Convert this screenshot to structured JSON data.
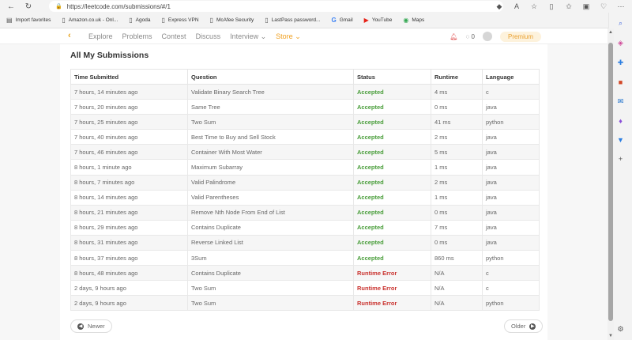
{
  "browser": {
    "url": "https://leetcode.com/submissions/#/1",
    "bookmarks": [
      {
        "label": "Import favorites"
      },
      {
        "label": "Amazon.co.uk - Onl..."
      },
      {
        "label": "Agoda"
      },
      {
        "label": "Express VPN"
      },
      {
        "label": "McAfee Security"
      },
      {
        "label": "LastPass password..."
      },
      {
        "label": "Gmail"
      },
      {
        "label": "YouTube"
      },
      {
        "label": "Maps"
      }
    ]
  },
  "header": {
    "nav": [
      "Explore",
      "Problems",
      "Contest",
      "Discuss",
      "Interview",
      "Store"
    ],
    "coins": "0",
    "premium": "Premium"
  },
  "page": {
    "title": "All My Submissions",
    "columns": [
      "Time Submitted",
      "Question",
      "Status",
      "Runtime",
      "Language"
    ],
    "rows": [
      {
        "time": "7 hours, 14 minutes ago",
        "question": "Validate Binary Search Tree",
        "status": "Accepted",
        "runtime": "4 ms",
        "lang": "c"
      },
      {
        "time": "7 hours, 20 minutes ago",
        "question": "Same Tree",
        "status": "Accepted",
        "runtime": "0 ms",
        "lang": "java"
      },
      {
        "time": "7 hours, 25 minutes ago",
        "question": "Two Sum",
        "status": "Accepted",
        "runtime": "41 ms",
        "lang": "python"
      },
      {
        "time": "7 hours, 40 minutes ago",
        "question": "Best Time to Buy and Sell Stock",
        "status": "Accepted",
        "runtime": "2 ms",
        "lang": "java"
      },
      {
        "time": "7 hours, 46 minutes ago",
        "question": "Container With Most Water",
        "status": "Accepted",
        "runtime": "5 ms",
        "lang": "java"
      },
      {
        "time": "8 hours, 1 minute ago",
        "question": "Maximum Subarray",
        "status": "Accepted",
        "runtime": "1 ms",
        "lang": "java"
      },
      {
        "time": "8 hours, 7 minutes ago",
        "question": "Valid Palindrome",
        "status": "Accepted",
        "runtime": "2 ms",
        "lang": "java"
      },
      {
        "time": "8 hours, 14 minutes ago",
        "question": "Valid Parentheses",
        "status": "Accepted",
        "runtime": "1 ms",
        "lang": "java"
      },
      {
        "time": "8 hours, 21 minutes ago",
        "question": "Remove Nth Node From End of List",
        "status": "Accepted",
        "runtime": "0 ms",
        "lang": "java"
      },
      {
        "time": "8 hours, 29 minutes ago",
        "question": "Contains Duplicate",
        "status": "Accepted",
        "runtime": "7 ms",
        "lang": "java"
      },
      {
        "time": "8 hours, 31 minutes ago",
        "question": "Reverse Linked List",
        "status": "Accepted",
        "runtime": "0 ms",
        "lang": "java"
      },
      {
        "time": "8 hours, 37 minutes ago",
        "question": "3Sum",
        "status": "Accepted",
        "runtime": "860 ms",
        "lang": "python"
      },
      {
        "time": "8 hours, 48 minutes ago",
        "question": "Contains Duplicate",
        "status": "Runtime Error",
        "runtime": "N/A",
        "lang": "c"
      },
      {
        "time": "2 days, 9 hours ago",
        "question": "Two Sum",
        "status": "Runtime Error",
        "runtime": "N/A",
        "lang": "c"
      },
      {
        "time": "2 days, 9 hours ago",
        "question": "Two Sum",
        "status": "Runtime Error",
        "runtime": "N/A",
        "lang": "python"
      }
    ],
    "newer": "Newer",
    "older": "Older"
  },
  "colors": {
    "accepted": "#4a9e3b",
    "error": "#c9302c",
    "store": "#f0a020",
    "premium_bg": "#fdf2dc"
  }
}
